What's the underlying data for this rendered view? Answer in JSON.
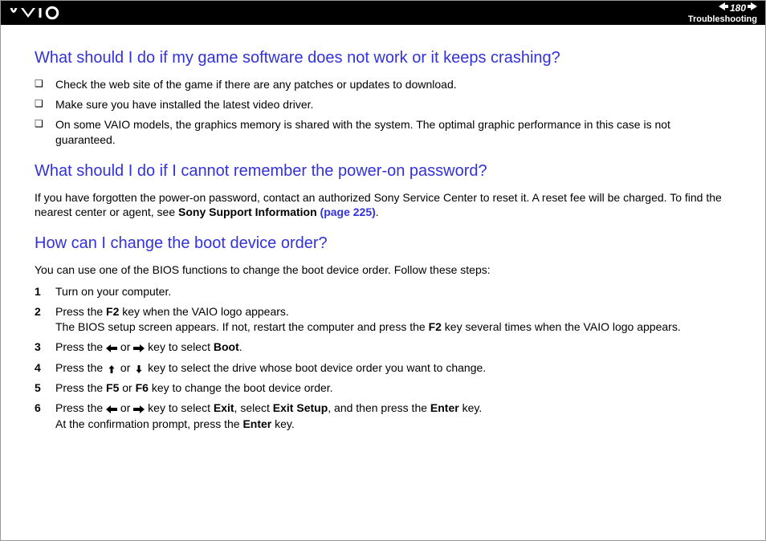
{
  "header": {
    "page_number": "180",
    "section": "Troubleshooting"
  },
  "sections": {
    "q1": {
      "heading": "What should I do if my game software does not work or it keeps crashing?",
      "bullets": [
        "Check the web site of the game if there are any patches or updates to download.",
        "Make sure you have installed the latest video driver.",
        "On some VAIO models, the graphics memory is shared with the system. The optimal graphic performance in this case is not guaranteed."
      ]
    },
    "q2": {
      "heading": "What should I do if I cannot remember the power-on password?",
      "body_pre": "If you have forgotten the power-on password, contact an authorized Sony Service Center to reset it. A reset fee will be charged. To find the nearest center or agent, see ",
      "body_link_label": "Sony Support Information",
      "body_link_page": " (page 225)",
      "body_post": "."
    },
    "q3": {
      "heading": "How can I change the boot device order?",
      "intro": "You can use one of the BIOS functions to change the boot device order. Follow these steps:",
      "steps": {
        "s1": "Turn on your computer.",
        "s2_a": "Press the ",
        "s2_b": " key when the VAIO logo appears.",
        "s2_c": "The BIOS setup screen appears. If not, restart the computer and press the ",
        "s2_d": " key several times when the VAIO logo appears.",
        "s3_a": "Press the ",
        "s3_b": " or ",
        "s3_c": " key to select ",
        "s3_boot": "Boot",
        "s3_d": ".",
        "s4_a": "Press the ",
        "s4_b": " or ",
        "s4_c": " key to select the drive whose boot device order you want to change.",
        "s5_a": "Press the ",
        "s5_b": " or ",
        "s5_c": " key to change the boot device order.",
        "s6_a": "Press the ",
        "s6_b": " or ",
        "s6_c": " key to select ",
        "s6_exit": "Exit",
        "s6_d": ", select ",
        "s6_exitsetup": "Exit Setup",
        "s6_e": ", and then press the ",
        "s6_enter": "Enter",
        "s6_f": " key.",
        "s6_g": "At the confirmation prompt, press the ",
        "s6_h": " key.",
        "key_f2": "F2",
        "key_f5": "F5",
        "key_f6": "F6",
        "num1": "1",
        "num2": "2",
        "num3": "3",
        "num4": "4",
        "num5": "5",
        "num6": "6"
      }
    }
  }
}
